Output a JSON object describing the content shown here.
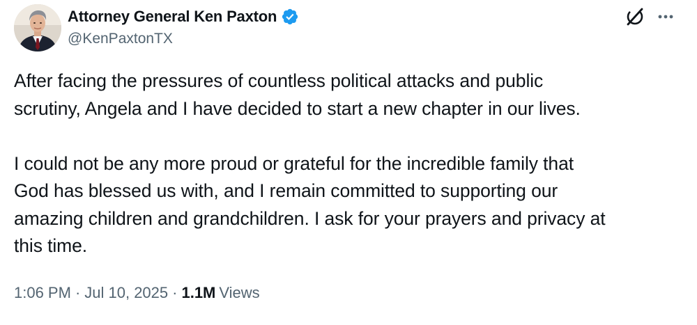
{
  "author": {
    "display_name": "Attorney General Ken Paxton",
    "handle": "@KenPaxtonTX",
    "verified": true,
    "verified_color": "#1d9bf0"
  },
  "icons": {
    "grok": "grok-icon",
    "more": "more-options-icon"
  },
  "tweet": {
    "paragraphs": [
      "After facing the pressures of countless political attacks and public\nscrutiny, Angela and I have decided to start a new chapter in our lives.",
      "I could not be any more proud or grateful for the incredible family that\nGod has blessed us with, and I remain committed to supporting our\namazing children and grandchildren. I ask for your prayers and privacy at\nthis time."
    ],
    "time": "1:06 PM",
    "date": "Jul 10, 2025",
    "separator": "·",
    "views_count": "1.1M",
    "views_label": "Views"
  },
  "colors": {
    "text_primary": "#0f1419",
    "text_secondary": "#536471"
  }
}
